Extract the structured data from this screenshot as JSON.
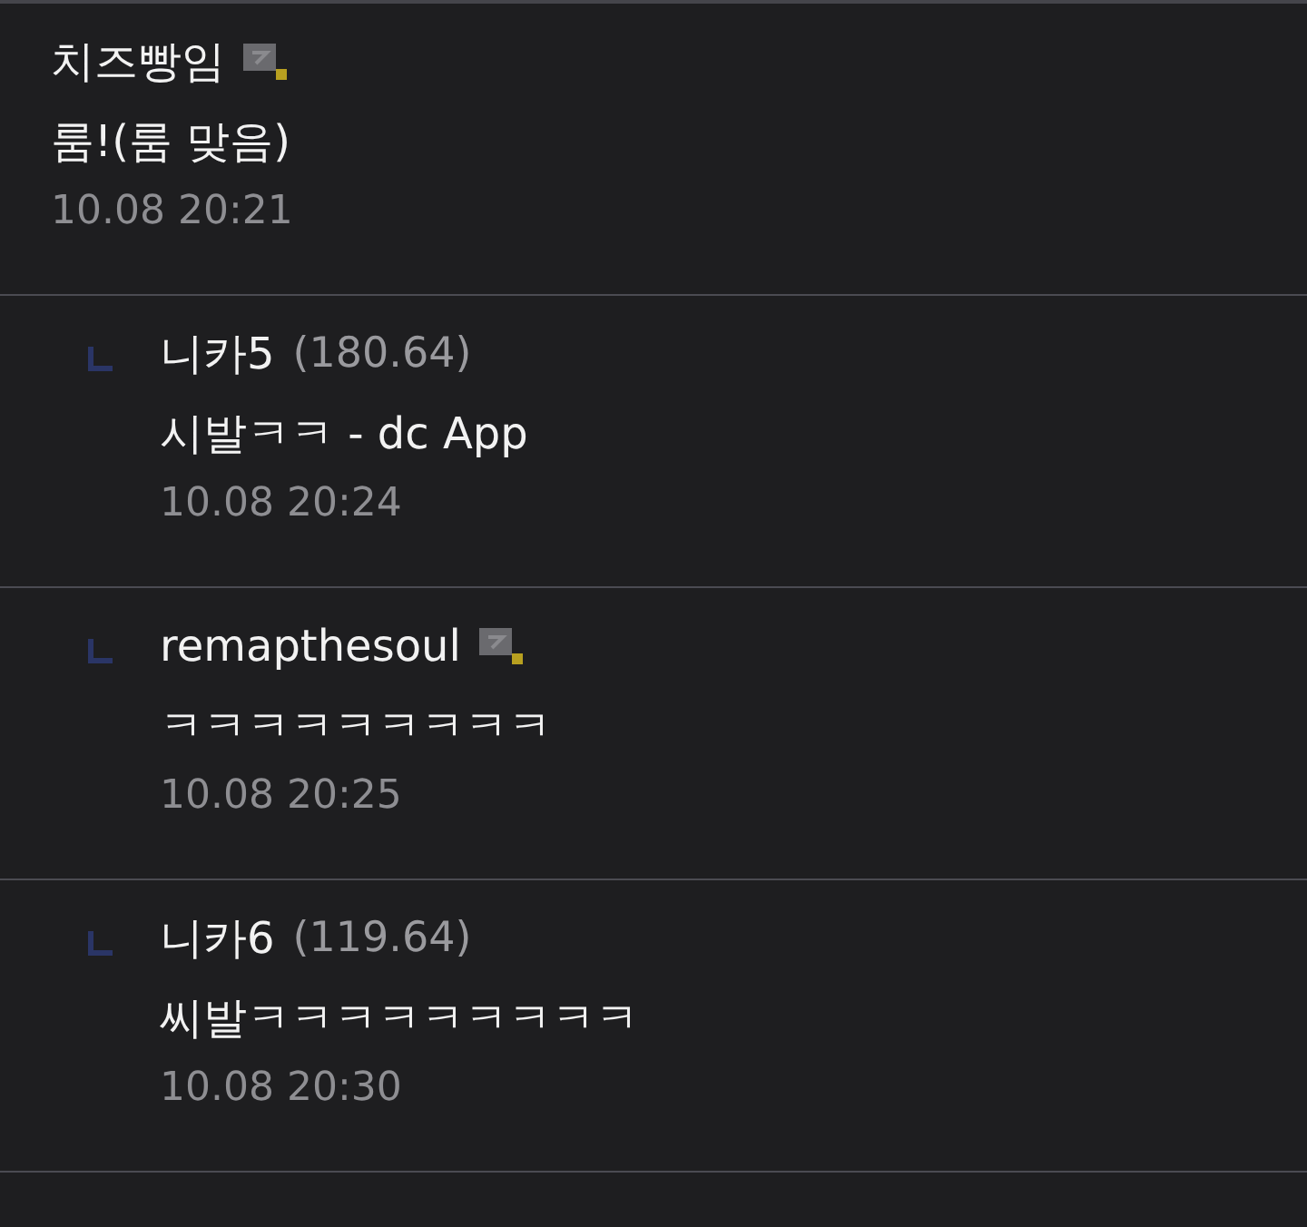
{
  "comments": [
    {
      "kind": "comment",
      "author": "치즈빵임",
      "badge": true,
      "text": "룸!(룸 맞음)",
      "time": "10.08 20:21"
    },
    {
      "kind": "reply",
      "author": "니카5",
      "ip": "(180.64)",
      "badge": false,
      "text": "시발ㅋㅋ - dc App",
      "time": "10.08 20:24"
    },
    {
      "kind": "reply",
      "author": "remapthesoul",
      "badge": true,
      "text": "ㅋㅋㅋㅋㅋㅋㅋㅋㅋ",
      "time": "10.08 20:25"
    },
    {
      "kind": "reply",
      "author": "니카6",
      "ip": "(119.64)",
      "badge": false,
      "text": "씨발ㅋㅋㅋㅋㅋㅋㅋㅋㅋ",
      "time": "10.08 20:30"
    }
  ]
}
